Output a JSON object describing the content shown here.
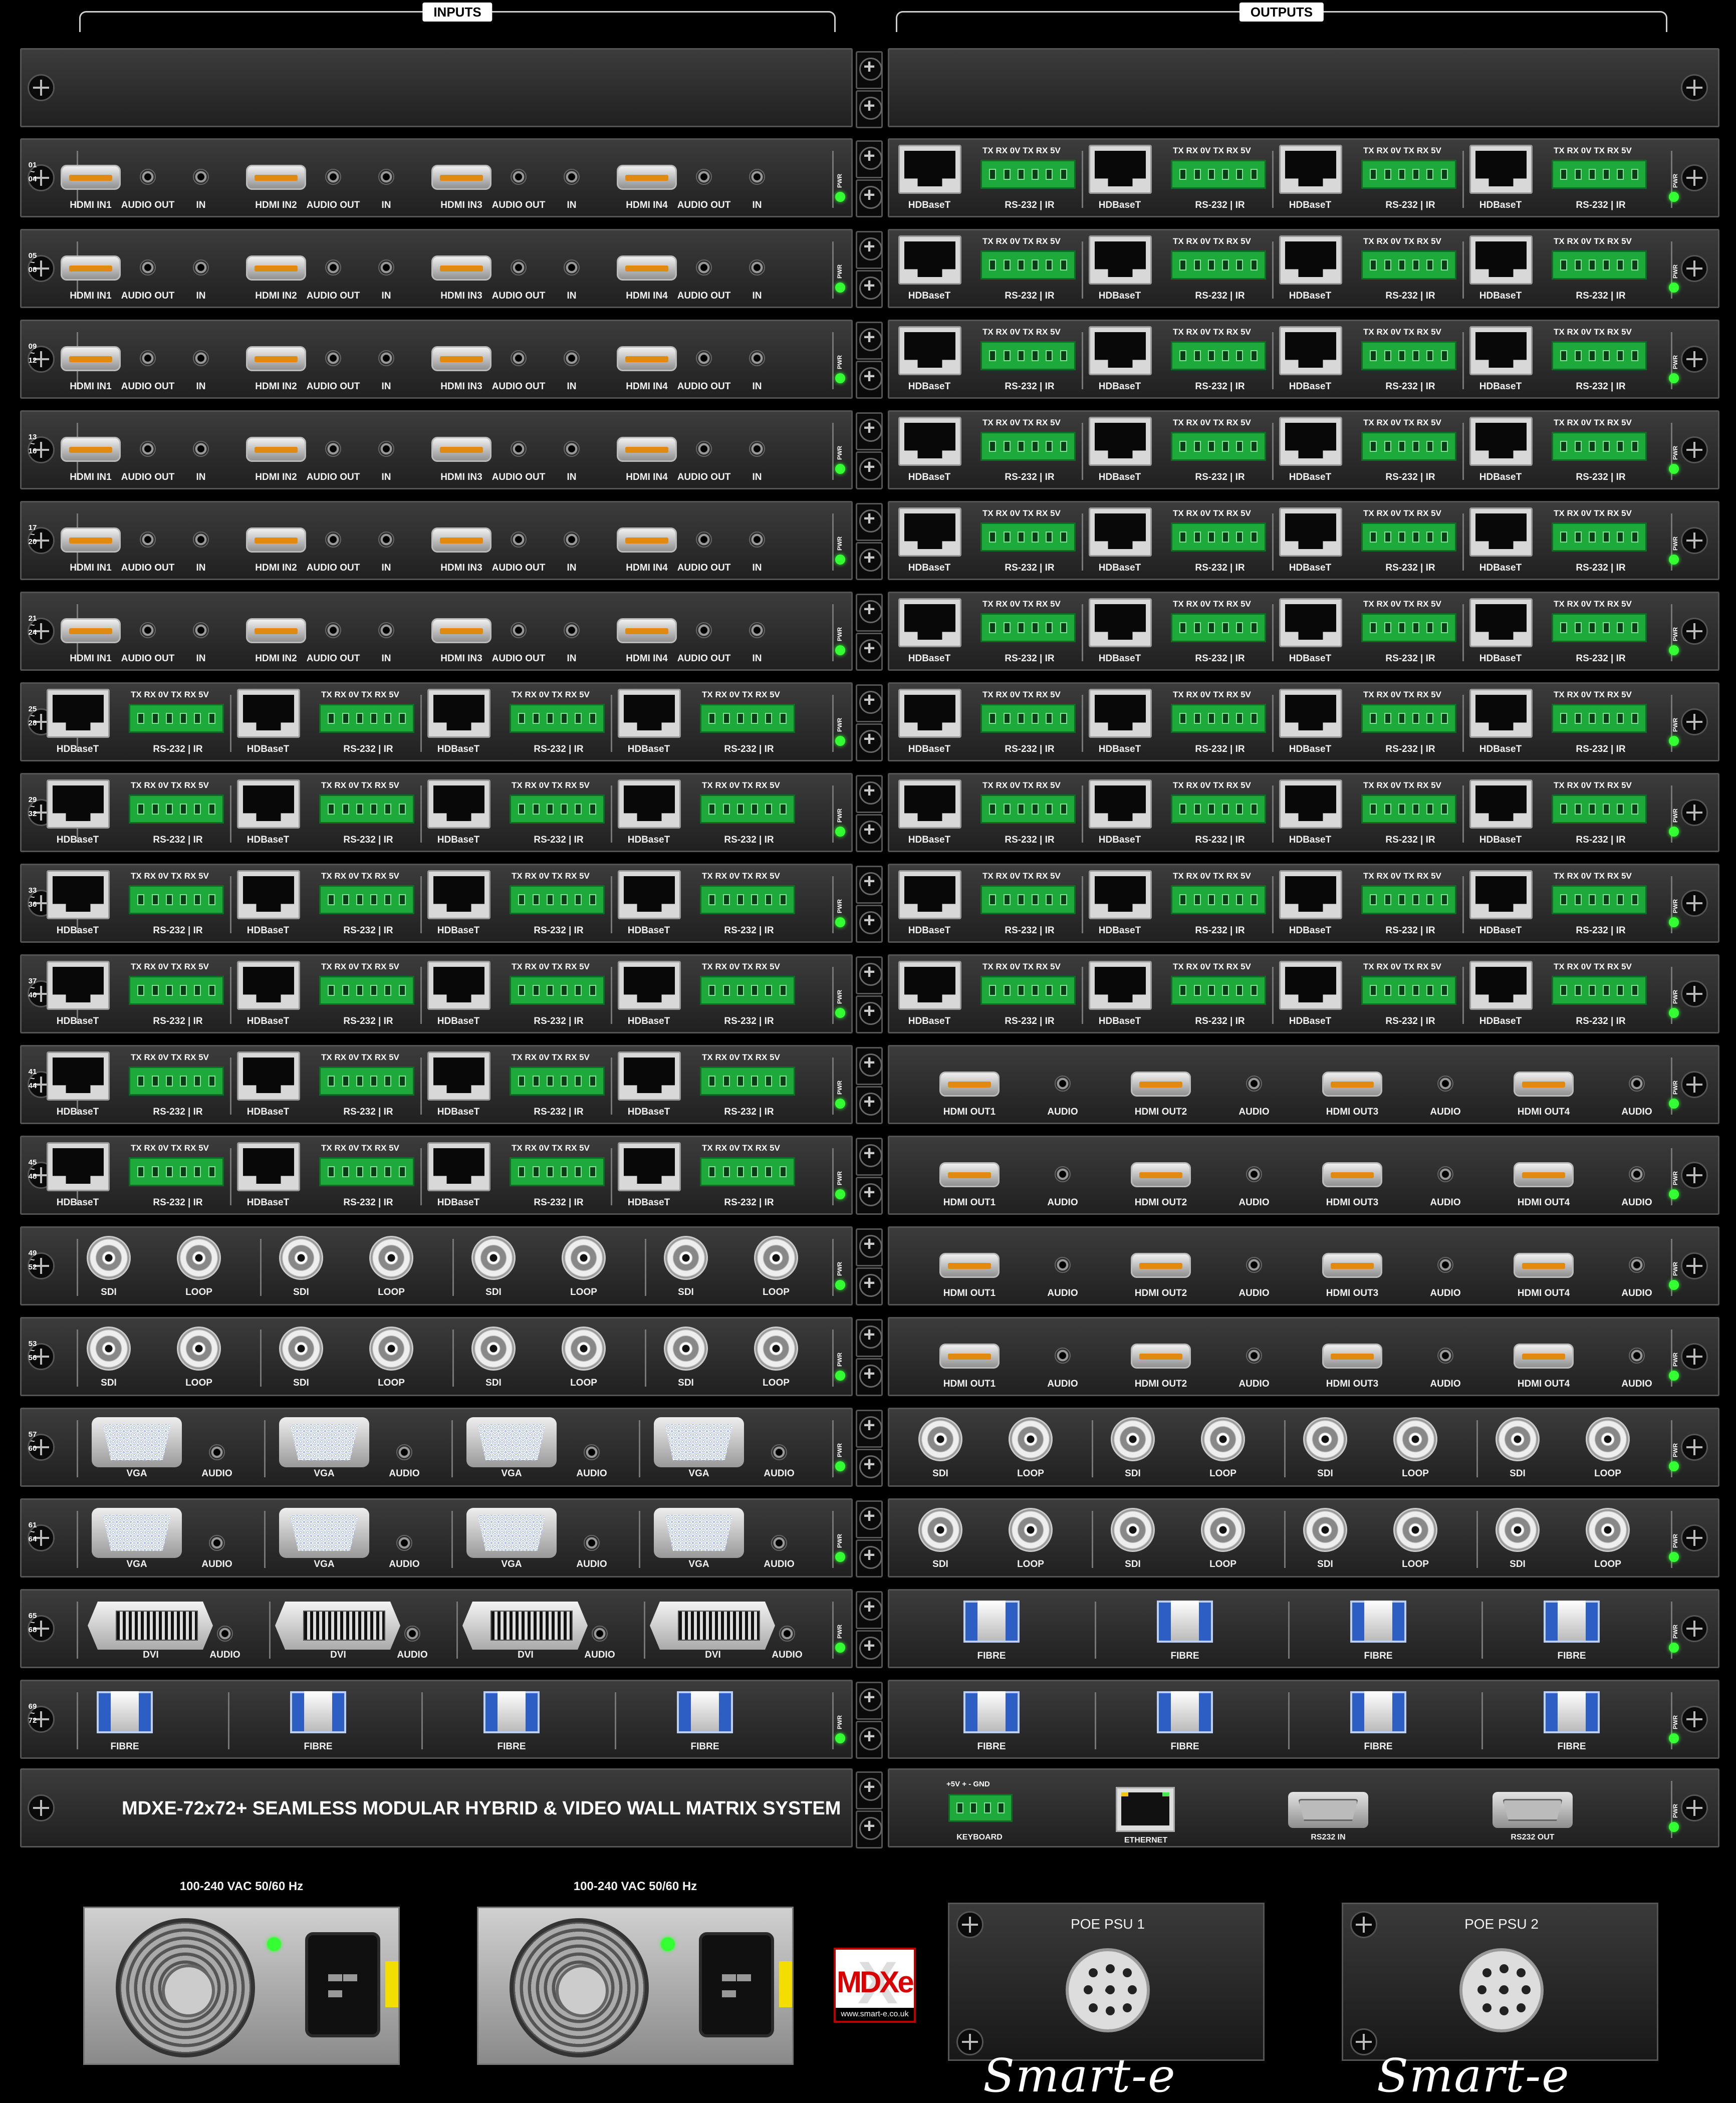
{
  "headers": {
    "inputs": "INPUTS",
    "outputs": "OUTPUTS"
  },
  "row_labels": [
    [
      "01",
      "~",
      "04"
    ],
    [
      "05",
      "~",
      "08"
    ],
    [
      "09",
      "~",
      "12"
    ],
    [
      "13",
      "~",
      "16"
    ],
    [
      "17",
      "~",
      "20"
    ],
    [
      "21",
      "~",
      "24"
    ],
    [
      "25",
      "~",
      "28"
    ],
    [
      "29",
      "~",
      "32"
    ],
    [
      "33",
      "~",
      "36"
    ],
    [
      "37",
      "~",
      "40"
    ],
    [
      "41",
      "~",
      "44"
    ],
    [
      "45",
      "~",
      "48"
    ],
    [
      "49",
      "~",
      "52"
    ],
    [
      "53",
      "~",
      "56"
    ],
    [
      "57",
      "~",
      "60"
    ],
    [
      "61",
      "~",
      "64"
    ],
    [
      "65",
      "~",
      "68"
    ],
    [
      "69",
      "~",
      "72"
    ]
  ],
  "input_cards": [
    "hdmi",
    "hdmi",
    "hdmi",
    "hdmi",
    "hdmi",
    "hdmi",
    "hdbt",
    "hdbt",
    "hdbt",
    "hdbt",
    "hdbt",
    "hdbt",
    "sdi",
    "sdi",
    "vga",
    "vga",
    "dvi",
    "fibre"
  ],
  "output_cards": [
    "hdbt",
    "hdbt",
    "hdbt",
    "hdbt",
    "hdbt",
    "hdbt",
    "hdbt",
    "hdbt",
    "hdbt",
    "hdbt",
    "hdmi",
    "hdmi",
    "hdmi",
    "hdmi",
    "sdi",
    "sdi",
    "fibre",
    "fibre"
  ],
  "labels": {
    "hdmi_in": [
      "HDMI IN1",
      "HDMI IN2",
      "HDMI IN3",
      "HDMI IN4"
    ],
    "hdmi_out": [
      "HDMI OUT1",
      "HDMI OUT2",
      "HDMI OUT3",
      "HDMI OUT4"
    ],
    "audio_out": "AUDIO OUT",
    "in": "IN",
    "audio": "AUDIO",
    "hdbaset": "HDBaseT",
    "pins": "TX RX 0V TX RX 5V",
    "rs232": "RS-232 | IR",
    "sdi": "SDI",
    "loop": "LOOP",
    "vga": "VGA",
    "dvi": "DVI",
    "fibre": "FIBRE",
    "pwr": "PWR"
  },
  "control_card": {
    "title": "MDXE-72x72+ SEAMLESS MODULAR HYBRID & VIDEO WALL MATRIX SYSTEM",
    "keyboard_pins": "+5V  +  -  GND",
    "keyboard": "KEYBOARD",
    "ethernet": "ETHERNET",
    "rs232_in": "RS232 IN",
    "rs232_out": "RS232 OUT"
  },
  "power": {
    "psu1_rating": "100-240 VAC 50/60 Hz",
    "psu2_rating": "100-240 VAC 50/60 Hz",
    "poe1": "POE PSU 1",
    "poe2": "POE PSU 2"
  },
  "logo": {
    "text": "MDXe",
    "url": "www.smart-e.co.uk"
  },
  "brand": "Smart-e",
  "colors": {
    "led": "#33ff33",
    "terminal_green": "#1eaa3a",
    "vga_blue": "#1f4fd1",
    "hdmi_orange": "#e08a12",
    "logo_red": "#d80000"
  }
}
